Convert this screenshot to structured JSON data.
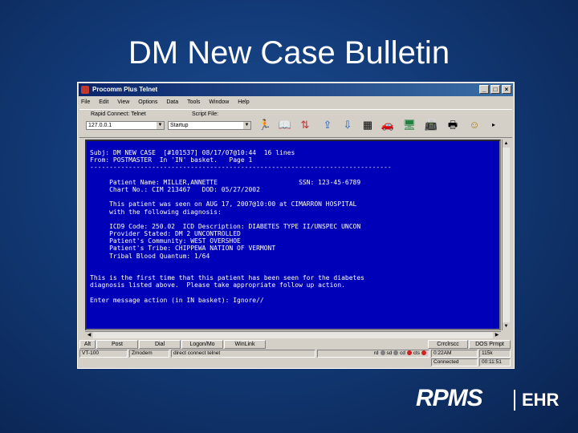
{
  "slide": {
    "title": "DM New Case Bulletin"
  },
  "window": {
    "title": "Procomm Plus Telnet",
    "buttons": {
      "minimize": "_",
      "maximize": "□",
      "close": "×"
    }
  },
  "menu": [
    "File",
    "Edit",
    "View",
    "Options",
    "Data",
    "Tools",
    "Window",
    "Help"
  ],
  "toolbar": {
    "connect_label": "Rapid Connect: Telnet",
    "connect_value": "127.0.0.1",
    "script_label": "Script File:",
    "script_value": "Startup",
    "dropdown_arrow": "▼"
  },
  "terminal": {
    "lines": [
      "Subj: DM NEW CASE  [#101537] 08/17/07@10:44  16 lines",
      "From: POSTMASTER  In 'IN' basket.   Page 1",
      "------------------------------------------------------------------------------",
      "",
      "     Patient Name: MILLER,ANNETTE                     SSN: 123-45-6789",
      "     Chart No.: CIM 213467   DOD: 05/27/2002",
      "",
      "     This patient was seen on AUG 17, 2007@10:00 at CIMARRON HOSPITAL",
      "     with the following diagnosis:",
      "",
      "     ICD9 Code: 250.02  ICD Description: DIABETES TYPE II/UNSPEC UNCON",
      "     Provider Stated: DM 2 UNCONTROLLED",
      "     Patient's Community: WEST OVERSHOE",
      "     Patient's Tribe: CHIPPEWA NATION OF VERMONT",
      "     Tribal Blood Quantum: 1/64",
      "",
      "",
      "This is the first time that this patient has been seen for the diabetes",
      "diagnosis listed above.  Please take appropriate follow up action.",
      "",
      "Enter message action (in IN basket): Ignore//"
    ]
  },
  "fkeys": [
    "Alt",
    "Post",
    "Dial",
    "Logon/Mo",
    "WinLink",
    "Crrclrscc",
    "DOS Prmpt"
  ],
  "status": {
    "emulation": "VT-100",
    "modem": "Zmodem",
    "connection": "direct connect telnet",
    "rd": "rd",
    "sd": "sd",
    "cd": "cd",
    "cts": "cts",
    "time": "0:22AM",
    "online": "Connected",
    "elapsed": "00:11:51",
    "extra": "115k",
    "led_colors": {
      "rd": "#808080",
      "sd": "#808080",
      "cd": "#d02020",
      "cts": "#d02020"
    }
  },
  "logo": {
    "brand": "RPMS",
    "suffix": "EHR"
  }
}
